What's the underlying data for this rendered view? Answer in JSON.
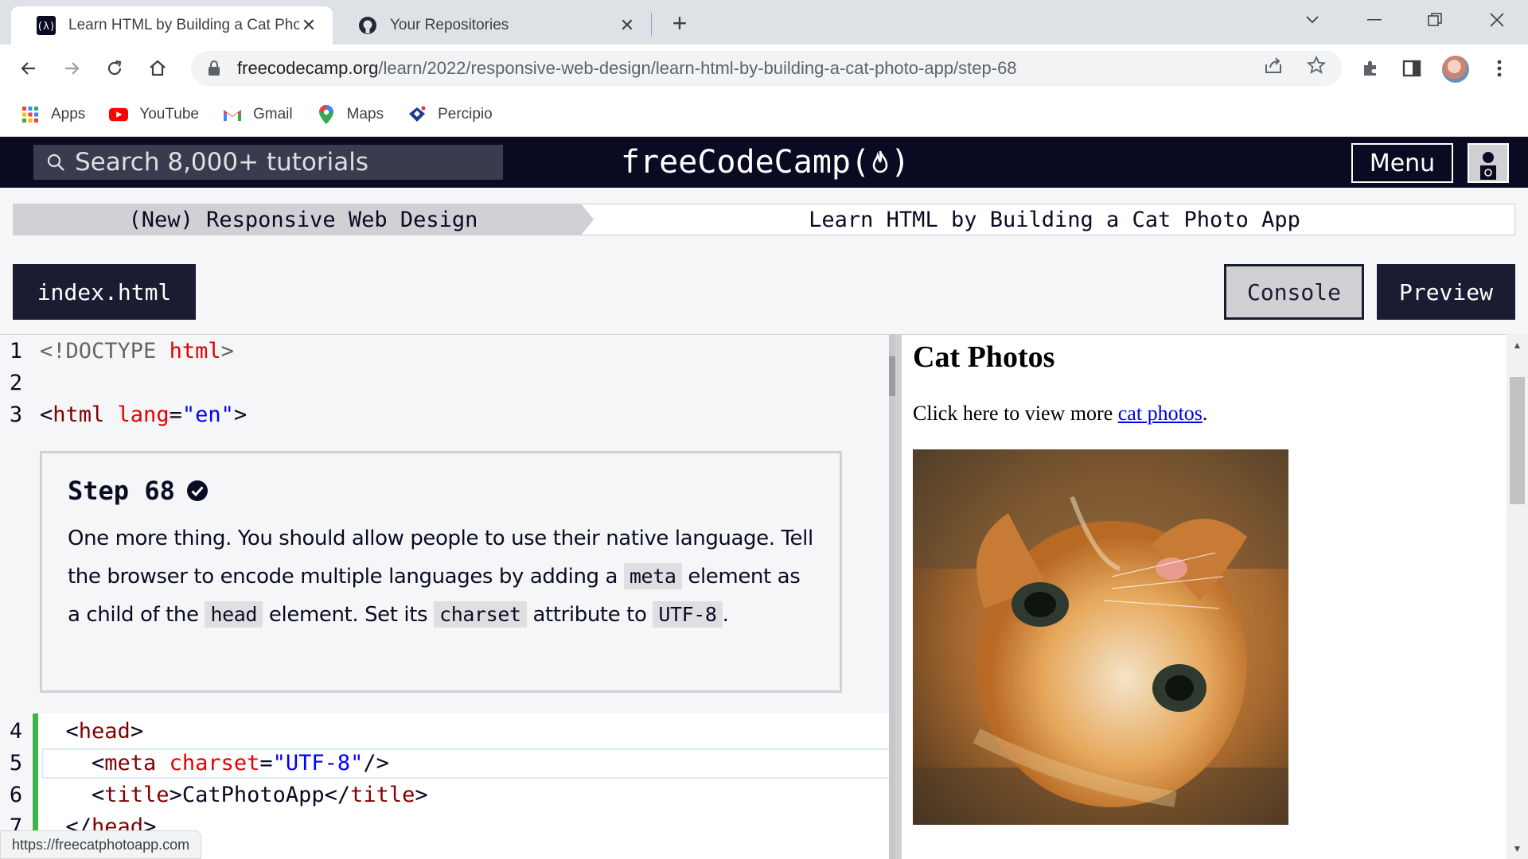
{
  "browser": {
    "tabs": [
      {
        "title": "Learn HTML by Building a Cat Photo App",
        "favicon": "freecodecamp-icon"
      },
      {
        "title": "Your Repositories",
        "favicon": "github-icon"
      }
    ],
    "address": {
      "host": "freecodecamp.org",
      "path": "/learn/2022/responsive-web-design/learn-html-by-building-a-cat-photo-app/step-68"
    },
    "bookmarks": [
      {
        "label": "Apps",
        "icon": "apps-grid-icon"
      },
      {
        "label": "YouTube",
        "icon": "youtube-icon"
      },
      {
        "label": "Gmail",
        "icon": "gmail-icon"
      },
      {
        "label": "Maps",
        "icon": "maps-pin-icon"
      },
      {
        "label": "Percipio",
        "icon": "percipio-icon"
      }
    ],
    "status_url": "https://freecatphotoapp.com"
  },
  "fcc": {
    "search_placeholder": "Search 8,000+ tutorials",
    "logo_text": "freeCodeCamp(",
    "logo_close": ")",
    "menu_label": "Menu",
    "breadcrumb": {
      "superblock": "(New) Responsive Web Design",
      "block": "Learn HTML by Building a Cat Photo App"
    },
    "file_tab": "index.html",
    "console_label": "Console",
    "preview_label": "Preview"
  },
  "editor": {
    "lines_top": [
      {
        "n": "1",
        "parts": [
          [
            "t-gray",
            "<!DOCTYPE "
          ],
          [
            "t-attr",
            "html"
          ],
          [
            "t-gray",
            ">"
          ]
        ]
      },
      {
        "n": "2",
        "parts": []
      },
      {
        "n": "3",
        "parts": [
          [
            "t-ink",
            "<"
          ],
          [
            "t-tag",
            "html "
          ],
          [
            "t-attr",
            "lang"
          ],
          [
            "t-ink",
            "="
          ],
          [
            "t-val",
            "\"en\""
          ],
          [
            "t-ink",
            ">"
          ]
        ]
      }
    ],
    "lines_bottom": [
      {
        "n": "4",
        "parts": [
          [
            "t-ink",
            "  <"
          ],
          [
            "t-tag",
            "head"
          ],
          [
            "t-ink",
            ">"
          ]
        ]
      },
      {
        "n": "5",
        "parts": [
          [
            "t-ink",
            "    <"
          ],
          [
            "t-tag",
            "meta "
          ],
          [
            "t-attr",
            "charset"
          ],
          [
            "t-ink",
            "="
          ],
          [
            "t-val",
            "\"UTF-8\""
          ],
          [
            "t-ink",
            "/>"
          ]
        ]
      },
      {
        "n": "6",
        "parts": [
          [
            "t-ink",
            "    <"
          ],
          [
            "t-tag",
            "title"
          ],
          [
            "t-ink",
            ">CatPhotoApp</"
          ],
          [
            "t-tag",
            "title"
          ],
          [
            "t-ink",
            ">"
          ]
        ]
      },
      {
        "n": "7",
        "parts": [
          [
            "t-ink",
            "  </"
          ],
          [
            "t-tag",
            "head"
          ],
          [
            "t-ink",
            ">"
          ]
        ]
      }
    ],
    "step": {
      "title": "Step 68",
      "text_1": "One more thing. You should allow people to use their native language. Tell the browser to encode multiple languages by adding a ",
      "code_1": "meta",
      "text_2": " element as a child of the ",
      "code_2": "head",
      "text_3": " element. Set its ",
      "code_3": "charset",
      "text_4": " attribute to ",
      "code_4": "UTF-8",
      "text_5": "."
    }
  },
  "preview": {
    "heading": "Cat Photos",
    "text_before": "Click here to view more ",
    "link_text": "cat photos",
    "text_after": "."
  }
}
